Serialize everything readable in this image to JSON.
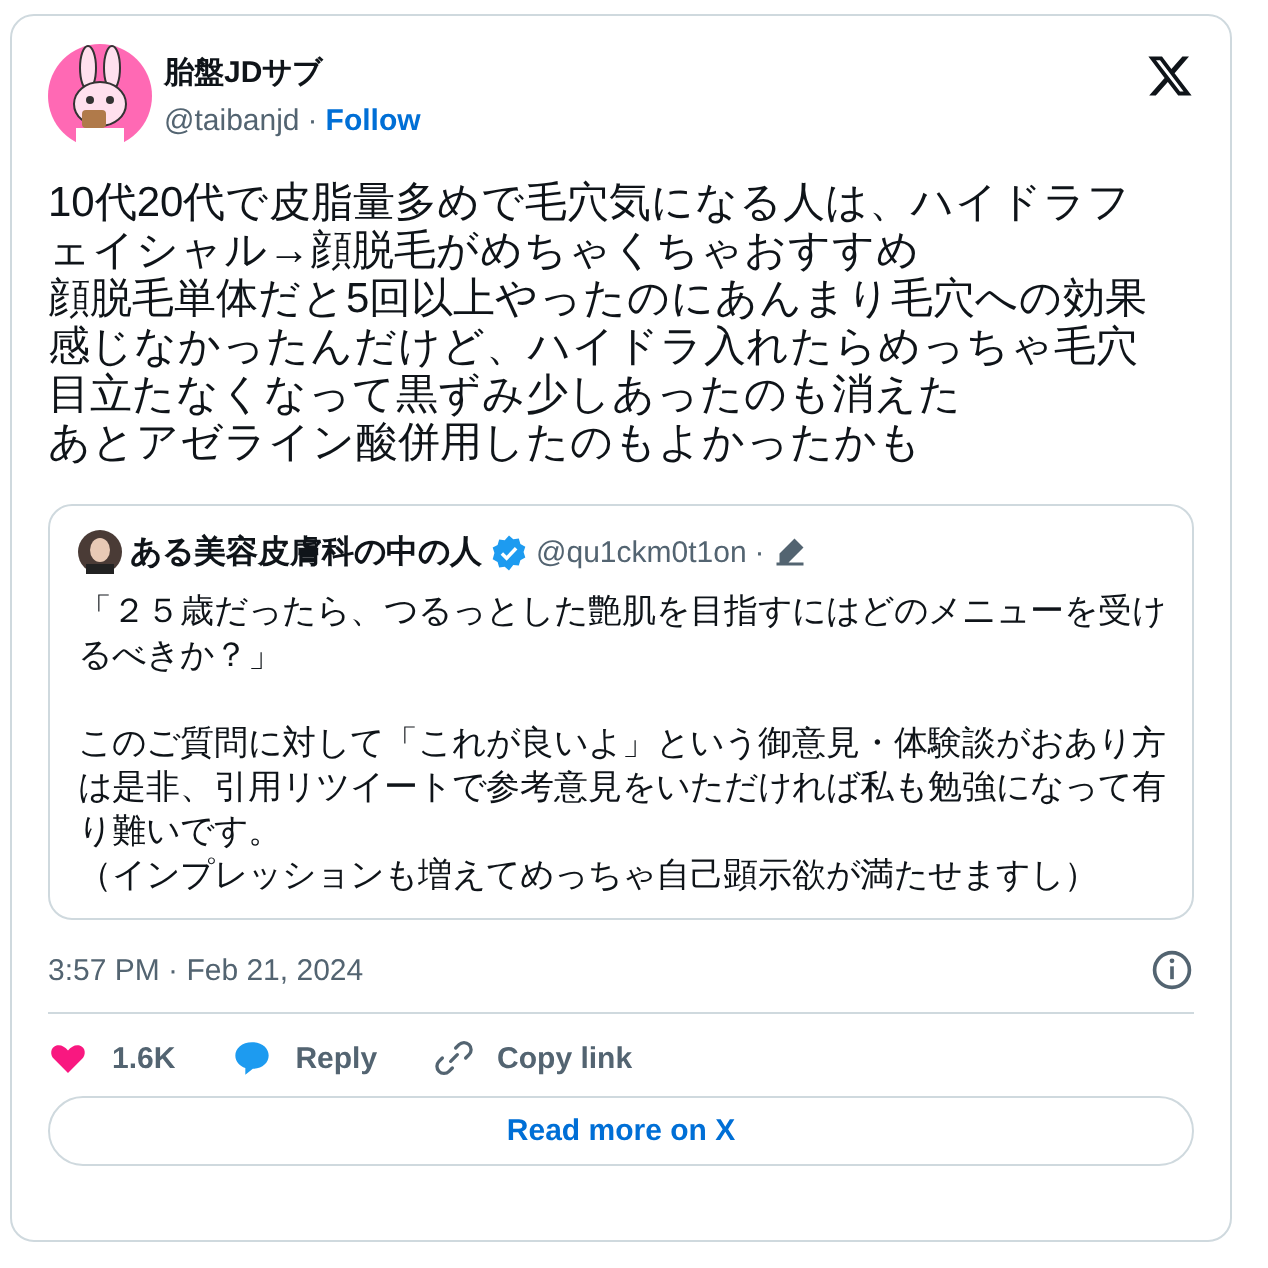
{
  "author": {
    "name": "胎盤JDサブ",
    "handle": "@taibanjd",
    "separator": "·",
    "follow": "Follow"
  },
  "text": [
    "10代20代で皮脂量多めで毛穴気になる人は、ハイドラフ",
    "ェイシャル→顔脱毛がめちゃくちゃおすすめ",
    "顔脱毛単体だと5回以上やったのにあんまり毛穴への効果",
    "感じなかったんだけど、ハイドラ入れたらめっちゃ毛穴",
    "目立たなくなって黒ずみ少しあったのも消えた",
    "あとアゼライン酸併用したのもよかったかも"
  ],
  "quoted": {
    "name": "ある美容皮膚科の中の人",
    "verified": true,
    "handle": "@qu1ckm0t1on",
    "separator": "·",
    "edited": true,
    "paragraphs": [
      [
        "「２５歳だったら、つるっとした艶肌を目指すにはどのメニューを受け",
        "るべきか？」"
      ],
      [
        "このご質問に対して「これが良いよ」という御意見・体験談がおあり方",
        "は是非、引用リツイートで参考意見をいただければ私も勉強になって有",
        "り難いです。",
        "（インプレッションも増えてめっちゃ自己顕示欲が満たせますし）"
      ]
    ]
  },
  "timestamp": "3:57 PM · Feb 21, 2024",
  "actions": [
    {
      "kind": "like",
      "label": "1.6K"
    },
    {
      "kind": "reply",
      "label": "Reply"
    },
    {
      "kind": "copy",
      "label": "Copy link"
    }
  ],
  "read_more": "Read more on X"
}
